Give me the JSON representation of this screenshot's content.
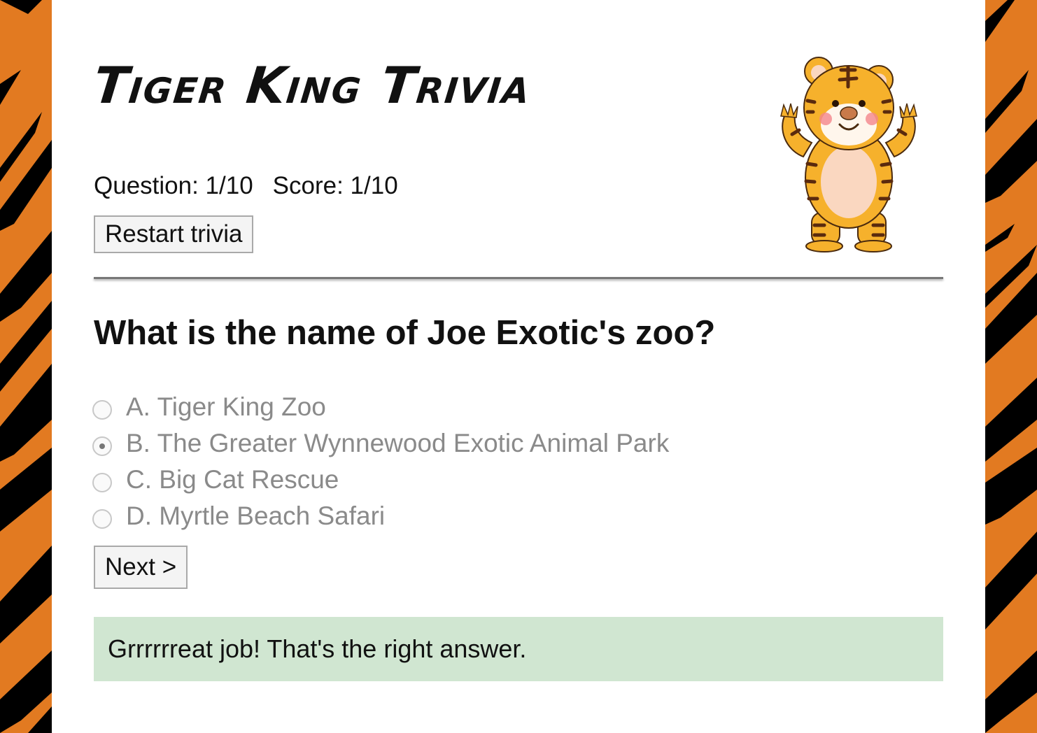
{
  "page": {
    "title": "Tiger King Trivia",
    "accent_color": "#e27a21",
    "stripe_color": "#000000"
  },
  "stats": {
    "question_label": "Question: 1/10",
    "score_label": "Score: 1/10"
  },
  "restart_button": {
    "label": "Restart trivia"
  },
  "mascot": {
    "icon": "tiger-mascot-icon"
  },
  "quiz": {
    "question": "What is the name of Joe Exotic's zoo?",
    "options": [
      {
        "label": "A. Tiger King Zoo",
        "selected": false
      },
      {
        "label": "B. The Greater Wynnewood Exotic Animal Park",
        "selected": true
      },
      {
        "label": "C. Big Cat Rescue",
        "selected": false
      },
      {
        "label": "D. Myrtle Beach Safari",
        "selected": false
      }
    ],
    "next_label": "Next >",
    "feedback": "Grrrrrreat job! That's the right answer.",
    "feedback_color": "#d0e6d1"
  }
}
